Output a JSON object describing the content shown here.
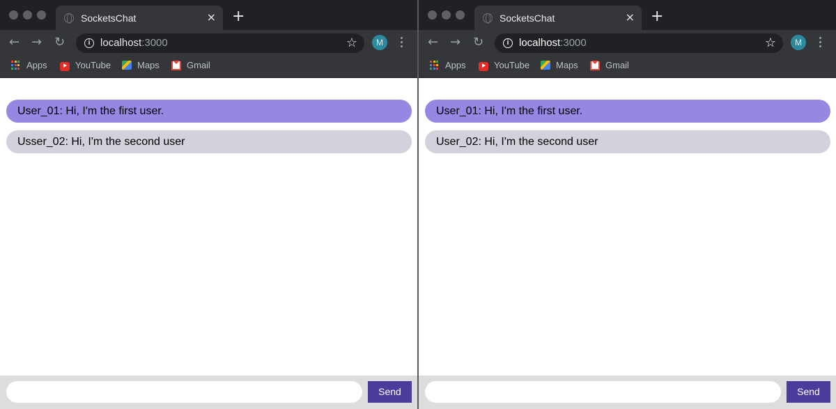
{
  "windows": [
    {
      "tab": {
        "title": "SocketsChat",
        "close": "×"
      },
      "new_tab": "+",
      "nav": {
        "back": "←",
        "forward": "→",
        "reload": "↻"
      },
      "url": {
        "host": "localhost",
        "port": ":3000"
      },
      "info_glyph": "i",
      "star": "☆",
      "avatar": "M",
      "bookmarks": [
        "Apps",
        "YouTube",
        "Maps",
        "Gmail"
      ],
      "messages": [
        "User_01: Hi, I'm the first user.",
        "Usser_02: Hi, I'm the second user"
      ],
      "input_value": "",
      "send_label": "Send"
    },
    {
      "tab": {
        "title": "SocketsChat",
        "close": "×"
      },
      "new_tab": "+",
      "nav": {
        "back": "←",
        "forward": "→",
        "reload": "↻"
      },
      "url": {
        "host": "localhost",
        "port": ":3000"
      },
      "info_glyph": "i",
      "star": "☆",
      "avatar": "M",
      "bookmarks": [
        "Apps",
        "YouTube",
        "Maps",
        "Gmail"
      ],
      "messages": [
        "User_01: Hi, I'm the first user.",
        "User_02: Hi, I'm the second user"
      ],
      "input_value": "",
      "send_label": "Send"
    }
  ],
  "colors": {
    "message_own": "#9488e3",
    "message_other": "#d3d2dc",
    "send_button": "#4b3b9a",
    "avatar_bg": "#2b8a9c"
  },
  "icons": [
    "globe-icon",
    "close-icon",
    "plus-icon",
    "back-arrow-icon",
    "forward-arrow-icon",
    "reload-icon",
    "info-icon",
    "star-icon",
    "kebab-menu-icon",
    "apps-grid-icon",
    "youtube-icon",
    "maps-icon",
    "gmail-icon"
  ]
}
